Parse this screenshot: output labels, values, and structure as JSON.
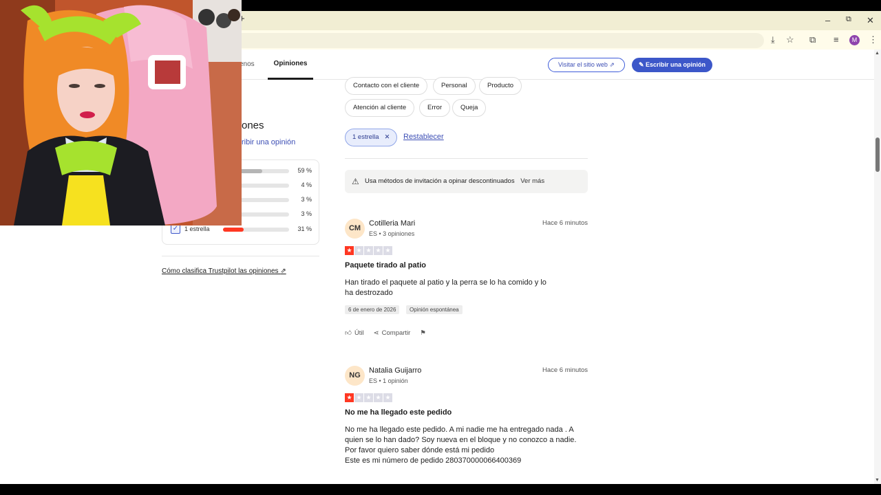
{
  "browser": {
    "new_tab": "+",
    "minimize": "–",
    "restore": "⧉",
    "close": "✕",
    "profile_initial": "M"
  },
  "subnav": {
    "partial_tab": "enos",
    "active_tab": "Opiniones",
    "visit_button": "Visitar el sitio web",
    "write_button": "Escribir una opinión"
  },
  "filters": {
    "chips": [
      "Contacto con el cliente",
      "Personal",
      "Producto",
      "Atención al cliente",
      "Error",
      "Queja"
    ],
    "active_filter": "1 estrella",
    "reset": "Restablecer"
  },
  "notice": {
    "text": "Usa métodos de invitación a opinar descontinuados",
    "more": "Ver más"
  },
  "sidebar": {
    "heading_partial": "ones",
    "write_link_partial": "ribir una opinión",
    "distribution": [
      {
        "label": "",
        "pct": "59 %",
        "value": 59,
        "color": "#b5b5b5"
      },
      {
        "label": "",
        "pct": "4 %",
        "value": 4,
        "color": "#b5b5b5"
      },
      {
        "label": "",
        "pct": "3 %",
        "value": 3,
        "color": "#b5b5b5"
      },
      {
        "label": "",
        "pct": "3 %",
        "value": 3,
        "color": "#b5b5b5"
      },
      {
        "label": "1 estrella",
        "pct": "31 %",
        "value": 31,
        "color": "#ff3722",
        "checked": true
      }
    ],
    "classify_link": "Cómo clasifica Trustpilot las opiniones"
  },
  "reviews": [
    {
      "initials": "CM",
      "name": "Cotilleria Mari",
      "meta": "ES • 3 opiniones",
      "time": "Hace 6 minutos",
      "stars": 1,
      "title": "Paquete tirado al patio",
      "body": "Han tirado el paquete al patio y la perra se lo ha comido y lo ha destrozado",
      "date_tag": "6 de enero de 2026",
      "type_tag": "Opinión espontánea",
      "useful": "Útil",
      "share": "Compartir"
    },
    {
      "initials": "NG",
      "name": "Natalia Guijarro",
      "meta": "ES • 1 opinión",
      "time": "Hace 6 minutos",
      "stars": 1,
      "title": "No me ha llegado este pedido",
      "body_lines": [
        "No me ha llegado este pedido. A mi nadie me ha entregado nada . A quien se lo han dado? Soy nueva en el bloque y no conozco a nadie. Por favor quiero saber dónde está mi pedido",
        "Este es mi número de pedido 280370000066400369"
      ]
    }
  ]
}
